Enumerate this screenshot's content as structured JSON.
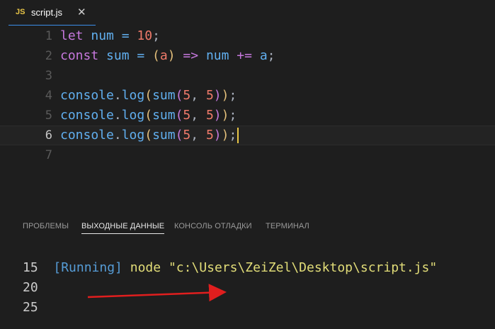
{
  "tab": {
    "icon": "JS",
    "title": "script.js",
    "close": "✕"
  },
  "editor": {
    "lines": [
      {
        "n": "1",
        "tokens": [
          [
            "let",
            "kw"
          ],
          [
            " num = ",
            "var"
          ],
          [
            "10",
            "num"
          ],
          [
            ";",
            "punc"
          ]
        ]
      },
      {
        "n": "2",
        "tokens": [
          [
            "const",
            "kw"
          ],
          [
            " sum = ",
            "var"
          ],
          [
            "(",
            "paren"
          ],
          [
            "a",
            "param"
          ],
          [
            ")",
            "paren"
          ],
          [
            " => ",
            "op"
          ],
          [
            "num ",
            "var"
          ],
          [
            "+=",
            "op"
          ],
          [
            " a",
            "var"
          ],
          [
            ";",
            "punc"
          ]
        ]
      },
      {
        "n": "3",
        "tokens": []
      },
      {
        "n": "4",
        "tokens": [
          [
            "console",
            "var"
          ],
          [
            ".",
            "punc"
          ],
          [
            "log",
            "fn"
          ],
          [
            "(",
            "paren"
          ],
          [
            "sum",
            "fn"
          ],
          [
            "(",
            "paren2"
          ],
          [
            "5",
            "num"
          ],
          [
            ", ",
            "punc"
          ],
          [
            "5",
            "num"
          ],
          [
            ")",
            "paren2"
          ],
          [
            ")",
            "paren"
          ],
          [
            ";",
            "punc"
          ]
        ]
      },
      {
        "n": "5",
        "tokens": [
          [
            "console",
            "var"
          ],
          [
            ".",
            "punc"
          ],
          [
            "log",
            "fn"
          ],
          [
            "(",
            "paren"
          ],
          [
            "sum",
            "fn"
          ],
          [
            "(",
            "paren2"
          ],
          [
            "5",
            "num"
          ],
          [
            ", ",
            "punc"
          ],
          [
            "5",
            "num"
          ],
          [
            ")",
            "paren2"
          ],
          [
            ")",
            "paren"
          ],
          [
            ";",
            "punc"
          ]
        ]
      },
      {
        "n": "6",
        "tokens": [
          [
            "console",
            "var"
          ],
          [
            ".",
            "punc"
          ],
          [
            "log",
            "fn"
          ],
          [
            "(",
            "paren"
          ],
          [
            "sum",
            "fn"
          ],
          [
            "(",
            "paren2"
          ],
          [
            "5",
            "num"
          ],
          [
            ", ",
            "punc"
          ],
          [
            "5",
            "num"
          ],
          [
            ")",
            "paren2"
          ],
          [
            ")",
            "paren"
          ],
          [
            ";",
            "punc"
          ]
        ],
        "current": true
      },
      {
        "n": "7",
        "tokens": []
      }
    ]
  },
  "panel": {
    "tabs": [
      {
        "label": "ПРОБЛЕМЫ",
        "active": false
      },
      {
        "label": "ВЫХОДНЫЕ ДАННЫЕ",
        "active": true
      },
      {
        "label": "КОНСОЛЬ ОТЛАДКИ",
        "active": false
      },
      {
        "label": "ТЕРМИНАЛ",
        "active": false
      }
    ],
    "running_tag": "[Running]",
    "running_cmd": " node ",
    "running_path": "\"c:\\Users\\ZeiZel\\Desktop\\script.js\"",
    "output_lines": [
      "15",
      "20",
      "25"
    ]
  },
  "colors": {
    "arrow": "#e01e1e",
    "accent": "#3b8eea"
  },
  "icons": {
    "annotation": "arrow-left-icon"
  }
}
